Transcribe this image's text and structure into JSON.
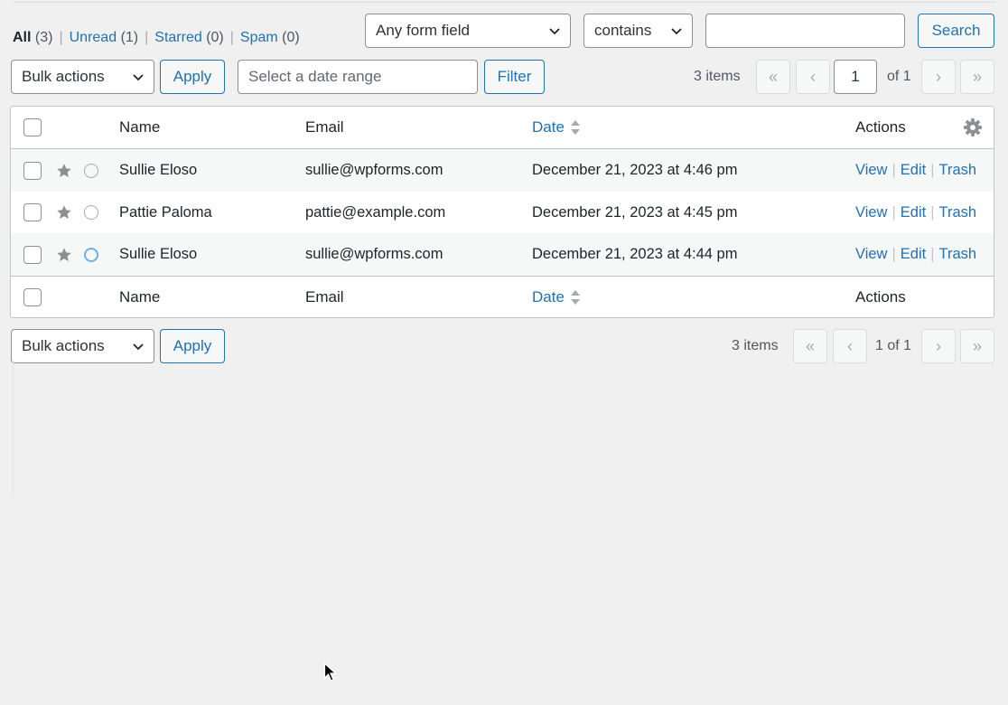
{
  "status_filter": {
    "all": {
      "label": "All",
      "count": "(3)"
    },
    "unread": {
      "label": "Unread",
      "count": "(1)"
    },
    "starred": {
      "label": "Starred",
      "count": "(0)"
    },
    "spam": {
      "label": "Spam",
      "count": "(0)"
    },
    "separator": "|"
  },
  "search": {
    "field_select": "Any form field",
    "operator_select": "contains",
    "input_value": "",
    "button_label": "Search"
  },
  "top_nav": {
    "bulk_actions": "Bulk actions",
    "apply_label": "Apply",
    "date_placeholder": "Select a date range",
    "filter_label": "Filter",
    "items_count": "3 items",
    "first_page": "«",
    "prev_page": "‹",
    "current_page": "1",
    "of_total": "of 1",
    "next_page": "›",
    "last_page": "»"
  },
  "table": {
    "columns": {
      "name": "Name",
      "email": "Email",
      "date": "Date",
      "actions": "Actions"
    },
    "action_labels": {
      "view": "View",
      "edit": "Edit",
      "trash": "Trash",
      "separator": "|"
    },
    "rows": [
      {
        "name": "Sullie Eloso",
        "email": "sullie@wpforms.com",
        "date": "December 21, 2023 at 4:46 pm",
        "unread": false
      },
      {
        "name": "Pattie Paloma",
        "email": "pattie@example.com",
        "date": "December 21, 2023 at 4:45 pm",
        "unread": false
      },
      {
        "name": "Sullie Eloso",
        "email": "sullie@wpforms.com",
        "date": "December 21, 2023 at 4:44 pm",
        "unread": true
      }
    ]
  },
  "bottom_nav": {
    "bulk_actions": "Bulk actions",
    "apply_label": "Apply",
    "items_count": "3 items",
    "first_page": "«",
    "prev_page": "‹",
    "page_status": "1 of 1",
    "next_page": "›",
    "last_page": "»"
  },
  "colors": {
    "accent": "#2271b1",
    "background": "#f0f0f1",
    "unread_indicator": "#72aee6",
    "star": "#8c8f94"
  },
  "icons": [
    "chevron-down-icon",
    "star-icon",
    "read-status-icon",
    "sort-icon",
    "gear-icon",
    "cursor-icon"
  ]
}
